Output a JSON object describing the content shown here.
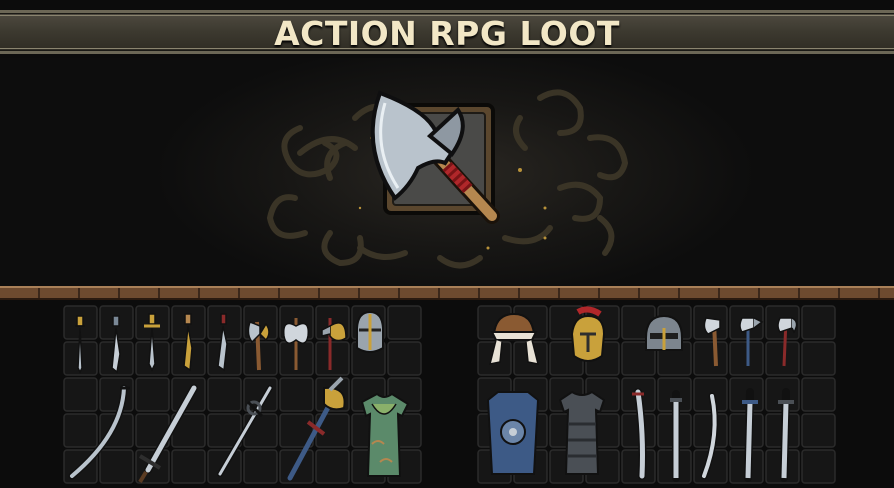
{
  "title": "ACTION RPG LOOT",
  "showcase": {
    "featured_icon": "battle-axe-icon"
  },
  "inventory_left": {
    "icons": [
      "dagger-icon",
      "dagger-icon",
      "short-sword-icon",
      "dagger-icon",
      "dagger-icon",
      "hand-axe-icon",
      "double-axe-icon",
      "war-axe-icon",
      "great-helm-icon",
      "scimitar-icon",
      "long-sword-icon",
      "rapier-icon",
      "halberd-icon",
      "leaf-tunic-icon"
    ]
  },
  "inventory_right": {
    "icons": [
      "fur-cap-icon",
      "plumed-helm-icon",
      "nasal-helm-icon",
      "hatchet-icon",
      "axe-icon",
      "axe-icon",
      "shield-armor-icon",
      "leather-armor-icon",
      "serrated-sword-icon",
      "sword-icon",
      "sickle-blade-icon",
      "sword-icon",
      "sword-icon"
    ]
  },
  "colors": {
    "banner": "#3f3b31",
    "title_text": "#f2e7c6",
    "metal": "#b9c3cc",
    "wood": "#8a5a32",
    "gold": "#c9a13b"
  }
}
